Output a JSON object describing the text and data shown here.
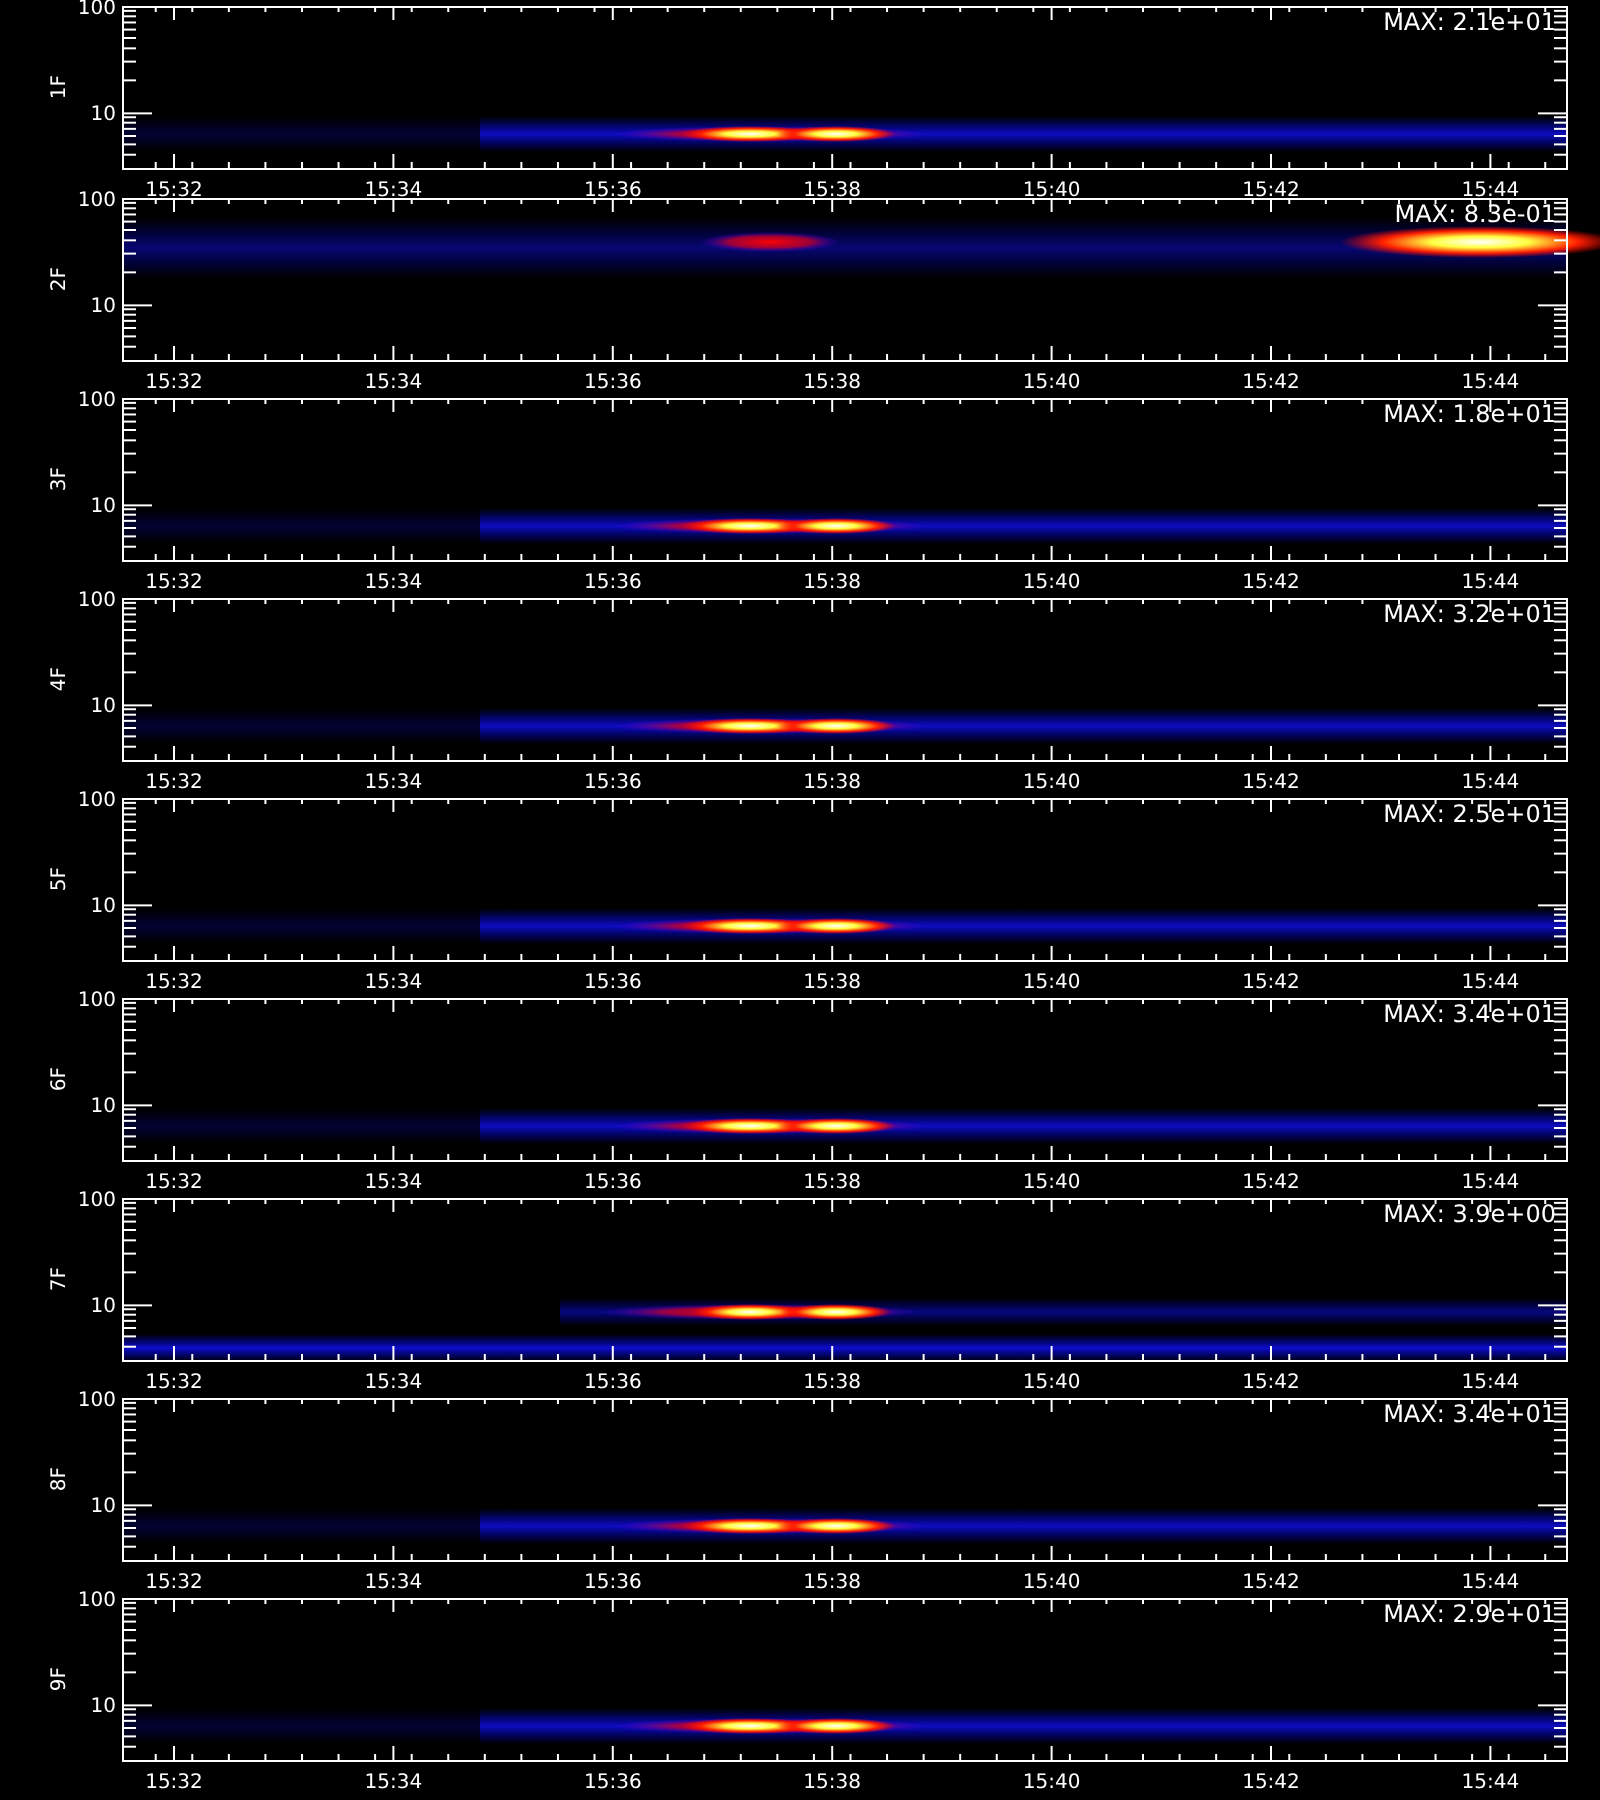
{
  "panels": [
    {
      "label": "1F",
      "max": "MAX: 2.1e+01",
      "y_ticks": [
        "100",
        "10"
      ],
      "x_ticks": [
        "15:32",
        "15:34",
        "15:36",
        "15:38",
        "15:40",
        "15:42",
        "15:44"
      ]
    },
    {
      "label": "2F",
      "max": "MAX: 8.3e-01",
      "y_ticks": [
        "100",
        "10"
      ],
      "x_ticks": [
        "15:32",
        "15:34",
        "15:36",
        "15:38",
        "15:40",
        "15:42",
        "15:44"
      ]
    },
    {
      "label": "3F",
      "max": "MAX: 1.8e+01",
      "y_ticks": [
        "100",
        "10"
      ],
      "x_ticks": [
        "15:32",
        "15:34",
        "15:36",
        "15:38",
        "15:40",
        "15:42",
        "15:44"
      ]
    },
    {
      "label": "4F",
      "max": "MAX: 3.2e+01",
      "y_ticks": [
        "100",
        "10"
      ],
      "x_ticks": [
        "15:32",
        "15:34",
        "15:36",
        "15:38",
        "15:40",
        "15:42",
        "15:44"
      ]
    },
    {
      "label": "5F",
      "max": "MAX: 2.5e+01",
      "y_ticks": [
        "100",
        "10"
      ],
      "x_ticks": [
        "15:32",
        "15:34",
        "15:36",
        "15:38",
        "15:40",
        "15:42",
        "15:44"
      ]
    },
    {
      "label": "6F",
      "max": "MAX: 3.4e+01",
      "y_ticks": [
        "100",
        "10"
      ],
      "x_ticks": [
        "15:32",
        "15:34",
        "15:36",
        "15:38",
        "15:40",
        "15:42",
        "15:44"
      ]
    },
    {
      "label": "7F",
      "max": "MAX: 3.9e+00",
      "y_ticks": [
        "100",
        "10"
      ],
      "x_ticks": [
        "15:32",
        "15:34",
        "15:36",
        "15:38",
        "15:40",
        "15:42",
        "15:44"
      ]
    },
    {
      "label": "8F",
      "max": "MAX: 3.4e+01",
      "y_ticks": [
        "100",
        "10"
      ],
      "x_ticks": [
        "15:32",
        "15:34",
        "15:36",
        "15:38",
        "15:40",
        "15:42",
        "15:44"
      ]
    },
    {
      "label": "9F",
      "max": "MAX: 2.9e+01",
      "y_ticks": [
        "100",
        "10"
      ],
      "x_ticks": [
        "15:32",
        "15:34",
        "15:36",
        "15:38",
        "15:40",
        "15:42",
        "15:44"
      ]
    }
  ]
}
